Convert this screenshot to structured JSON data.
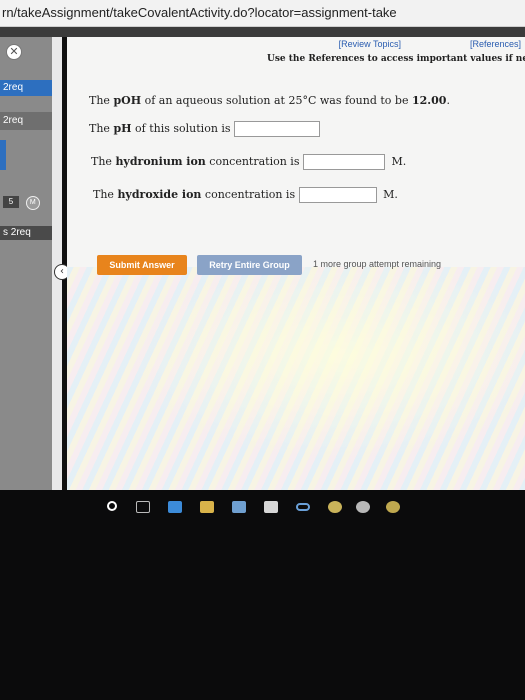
{
  "browser": {
    "url_text": "rn/takeAssignment/takeCovalentActivity.do?locator=assignment-take"
  },
  "sidebar": {
    "items": [
      {
        "label": "2req",
        "active": true
      },
      {
        "label": "2req",
        "active": false
      },
      {
        "label": "5",
        "badge": "M"
      },
      {
        "label": "2req",
        "prefix": "s"
      }
    ]
  },
  "header": {
    "review_topics": "[Review Topics]",
    "references": "[References]",
    "note": "Use the References to access important values if needed for this q"
  },
  "question": {
    "prompt_pre": "The ",
    "prompt_bold": "pOH",
    "prompt_mid": " of an aqueous solution at 25°C was found to be ",
    "prompt_value": "12.00",
    "prompt_end": ".",
    "ph_label_pre": "The ",
    "ph_label_bold": "pH",
    "ph_label_post": " of this solution is",
    "hydronium_pre": "The ",
    "hydronium_bold": "hydronium ion",
    "hydronium_post": " concentration is",
    "hydroxide_pre": "The ",
    "hydroxide_bold": "hydroxide ion",
    "hydroxide_post": " concentration is",
    "unit": "M."
  },
  "actions": {
    "submit": "Submit Answer",
    "retry": "Retry Entire Group",
    "attempts": "1 more group attempt remaining"
  },
  "taskbar": {
    "icons": [
      "search-icon",
      "task-view-icon",
      "edge-icon",
      "folder-icon",
      "store-icon",
      "mail-icon",
      "lock-icon",
      "link-icon",
      "chrome-icon",
      "settings-icon",
      "bell-icon"
    ]
  }
}
